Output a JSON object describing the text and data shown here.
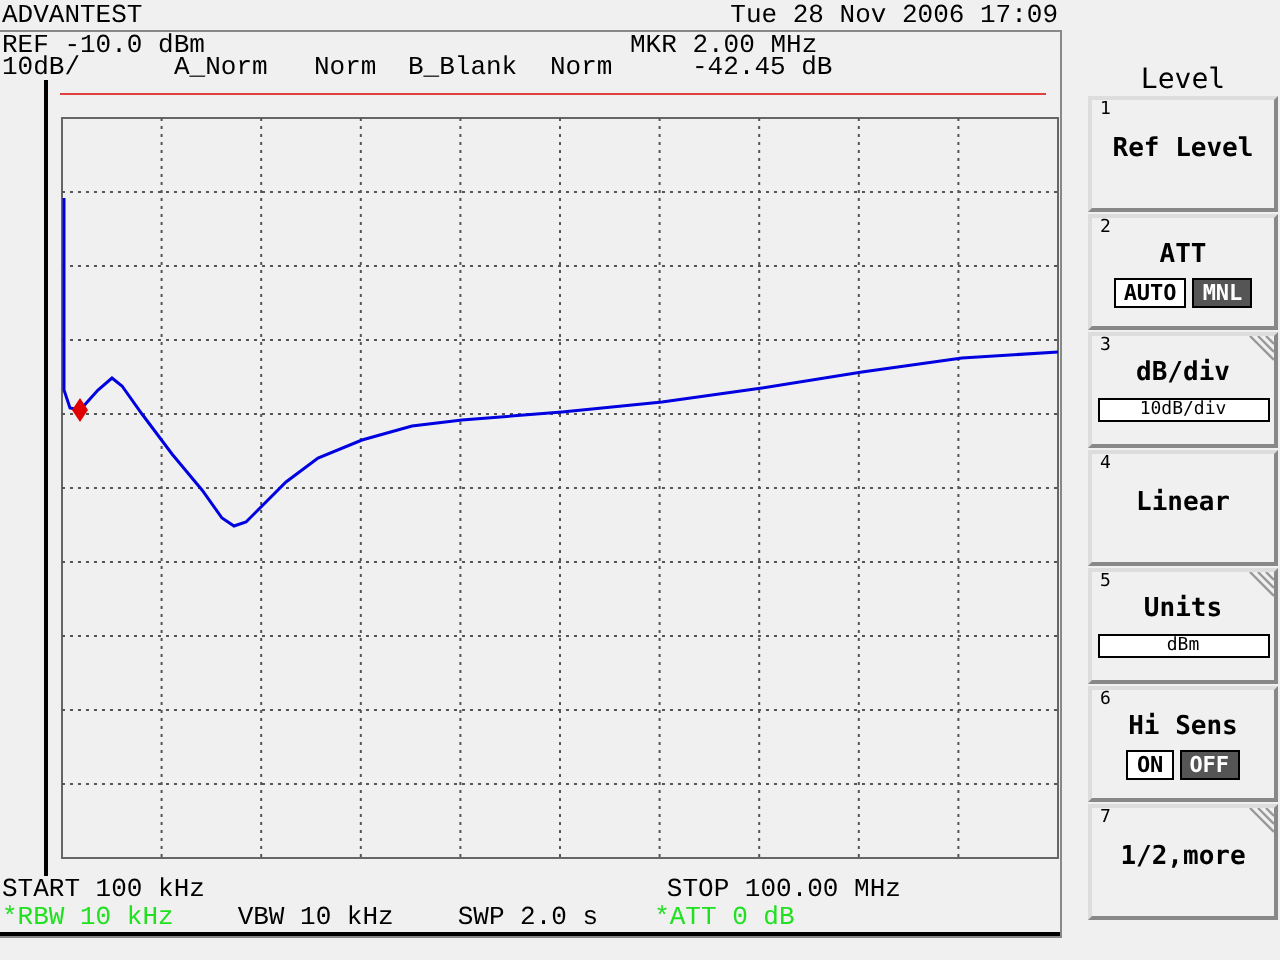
{
  "header": {
    "brand": "ADVANTEST",
    "datetime": "Tue 28 Nov 2006 17:09"
  },
  "info": {
    "ref": "REF -10.0 dBm",
    "marker": "MKR 2.00 MHz",
    "scale": "10dB/",
    "trace_a": "A_Norm",
    "trace_a_mode": "Norm",
    "trace_b": "B_Blank",
    "trace_b_mode": "Norm",
    "marker_level": "-42.45 dB"
  },
  "footer": {
    "start": "START 100 kHz",
    "stop": "STOP 100.00 MHz",
    "settings": [
      {
        "text": "*RBW 10 kHz",
        "manual": true
      },
      {
        "text": "VBW 10 kHz",
        "manual": false
      },
      {
        "text": "SWP 2.0 s",
        "manual": false
      },
      {
        "text": "*ATT 0 dB",
        "manual": true
      }
    ]
  },
  "softkeys": {
    "title": "Level",
    "keys": [
      {
        "number": "1",
        "label": "Ref Level",
        "kind": "plain",
        "submenu": false
      },
      {
        "number": "2",
        "label": "ATT",
        "kind": "toggle",
        "submenu": false,
        "options": [
          {
            "label": "AUTO",
            "selected": false
          },
          {
            "label": "MNL",
            "selected": true
          }
        ]
      },
      {
        "number": "3",
        "label": "dB/div",
        "kind": "value",
        "submenu": true,
        "value": "10dB/div"
      },
      {
        "number": "4",
        "label": "Linear",
        "kind": "plain",
        "submenu": false
      },
      {
        "number": "5",
        "label": "Units",
        "kind": "value",
        "submenu": true,
        "value": "dBm"
      },
      {
        "number": "6",
        "label": "Hi Sens",
        "kind": "toggle",
        "submenu": false,
        "options": [
          {
            "label": "ON",
            "selected": false
          },
          {
            "label": "OFF",
            "selected": true
          }
        ]
      },
      {
        "number": "7",
        "label": "1/2,more",
        "kind": "plain",
        "submenu": true
      }
    ]
  }
}
